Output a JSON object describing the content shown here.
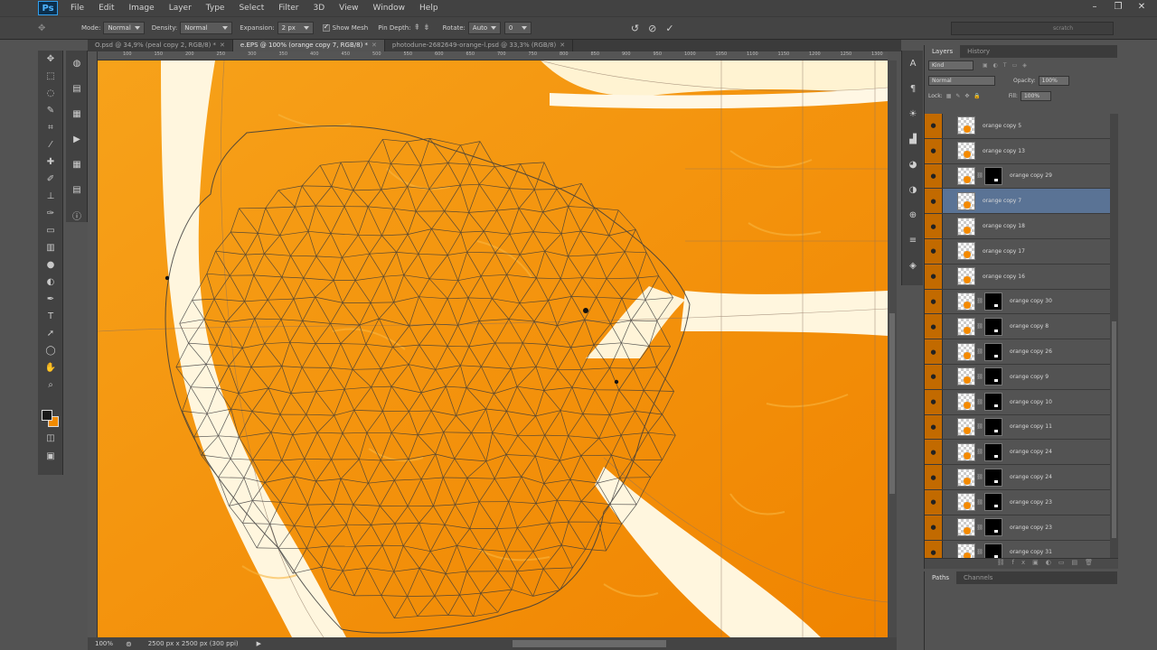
{
  "menu": {
    "logo": "Ps",
    "items": [
      "File",
      "Edit",
      "Image",
      "Layer",
      "Type",
      "Select",
      "Filter",
      "3D",
      "View",
      "Window",
      "Help"
    ],
    "window_controls": [
      "–",
      "❐",
      "✕"
    ]
  },
  "options": {
    "mode_label": "Mode:",
    "mode_value": "Normal",
    "density_label": "Density:",
    "density_value": "Normal",
    "expansion_label": "Expansion:",
    "expansion_value": "2 px",
    "show_mesh_label": "Show Mesh",
    "show_mesh_checked": true,
    "pin_depth_label": "Pin Depth:",
    "rotate_label": "Rotate:",
    "rotate_value": "Auto",
    "rotate_degrees": "0",
    "search_placeholder": "scratch"
  },
  "tabs": [
    {
      "label": "O.psd @ 34,9% (peal copy 2, RGB/8) *",
      "active": false
    },
    {
      "label": "e.EPS @ 100% (orange copy 7, RGB/8) *",
      "active": true
    },
    {
      "label": "photodune-2682649-orange-l.psd @ 33,3% (RGB/8)",
      "active": false
    }
  ],
  "ruler_labels": [
    "100",
    "150",
    "200",
    "250",
    "300",
    "350",
    "400",
    "450",
    "500",
    "550",
    "600",
    "650",
    "700",
    "750",
    "800",
    "850",
    "900",
    "950",
    "1000",
    "1050",
    "1100",
    "1150",
    "1200",
    "1250",
    "1300"
  ],
  "status": {
    "zoom": "100%",
    "doc_info": "2500 px x 2500 px (300 ppi)"
  },
  "layers_panel": {
    "tabs": [
      "Layers",
      "History"
    ],
    "kind_label": "Kind",
    "blend_mode": "Normal",
    "opacity_label": "Opacity:",
    "opacity_value": "100%",
    "lock_label": "Lock:",
    "fill_label": "Fill:",
    "fill_value": "100%",
    "layers": [
      {
        "name": "orange copy 5",
        "mask": false,
        "selected": false
      },
      {
        "name": "orange copy 13",
        "mask": false,
        "selected": false
      },
      {
        "name": "orange copy 29",
        "mask": true,
        "selected": false
      },
      {
        "name": "orange copy 7",
        "mask": false,
        "selected": true
      },
      {
        "name": "orange copy 18",
        "mask": false,
        "selected": false
      },
      {
        "name": "orange copy 17",
        "mask": false,
        "selected": false
      },
      {
        "name": "orange copy 16",
        "mask": false,
        "selected": false
      },
      {
        "name": "orange copy 30",
        "mask": true,
        "selected": false
      },
      {
        "name": "orange copy 8",
        "mask": true,
        "selected": false
      },
      {
        "name": "orange copy 26",
        "mask": true,
        "selected": false
      },
      {
        "name": "orange copy 9",
        "mask": true,
        "selected": false
      },
      {
        "name": "orange copy 10",
        "mask": true,
        "selected": false
      },
      {
        "name": "orange copy 11",
        "mask": true,
        "selected": false
      },
      {
        "name": "orange copy 24",
        "mask": true,
        "selected": false
      },
      {
        "name": "orange copy 24",
        "mask": true,
        "selected": false
      },
      {
        "name": "orange copy 23",
        "mask": true,
        "selected": false
      },
      {
        "name": "orange copy 23",
        "mask": true,
        "selected": false
      },
      {
        "name": "orange copy 31",
        "mask": true,
        "selected": false
      }
    ]
  },
  "paths_panel": {
    "tabs": [
      "Paths",
      "Channels"
    ]
  },
  "colors": {
    "foreground": "#1a1a1a",
    "background": "#f18b00",
    "orange": "#f48a00",
    "selected_layer": "#5a7395"
  },
  "icons": {
    "toolbar": [
      "move-icon",
      "marquee-icon",
      "lasso-icon",
      "quick-select-icon",
      "crop-icon",
      "eyedropper-icon",
      "healing-icon",
      "brush-icon",
      "stamp-icon",
      "history-brush-icon",
      "eraser-icon",
      "gradient-icon",
      "blur-icon",
      "dodge-icon",
      "pen-icon",
      "type-icon",
      "path-select-icon",
      "shape-icon",
      "hand-icon",
      "zoom-icon"
    ]
  }
}
